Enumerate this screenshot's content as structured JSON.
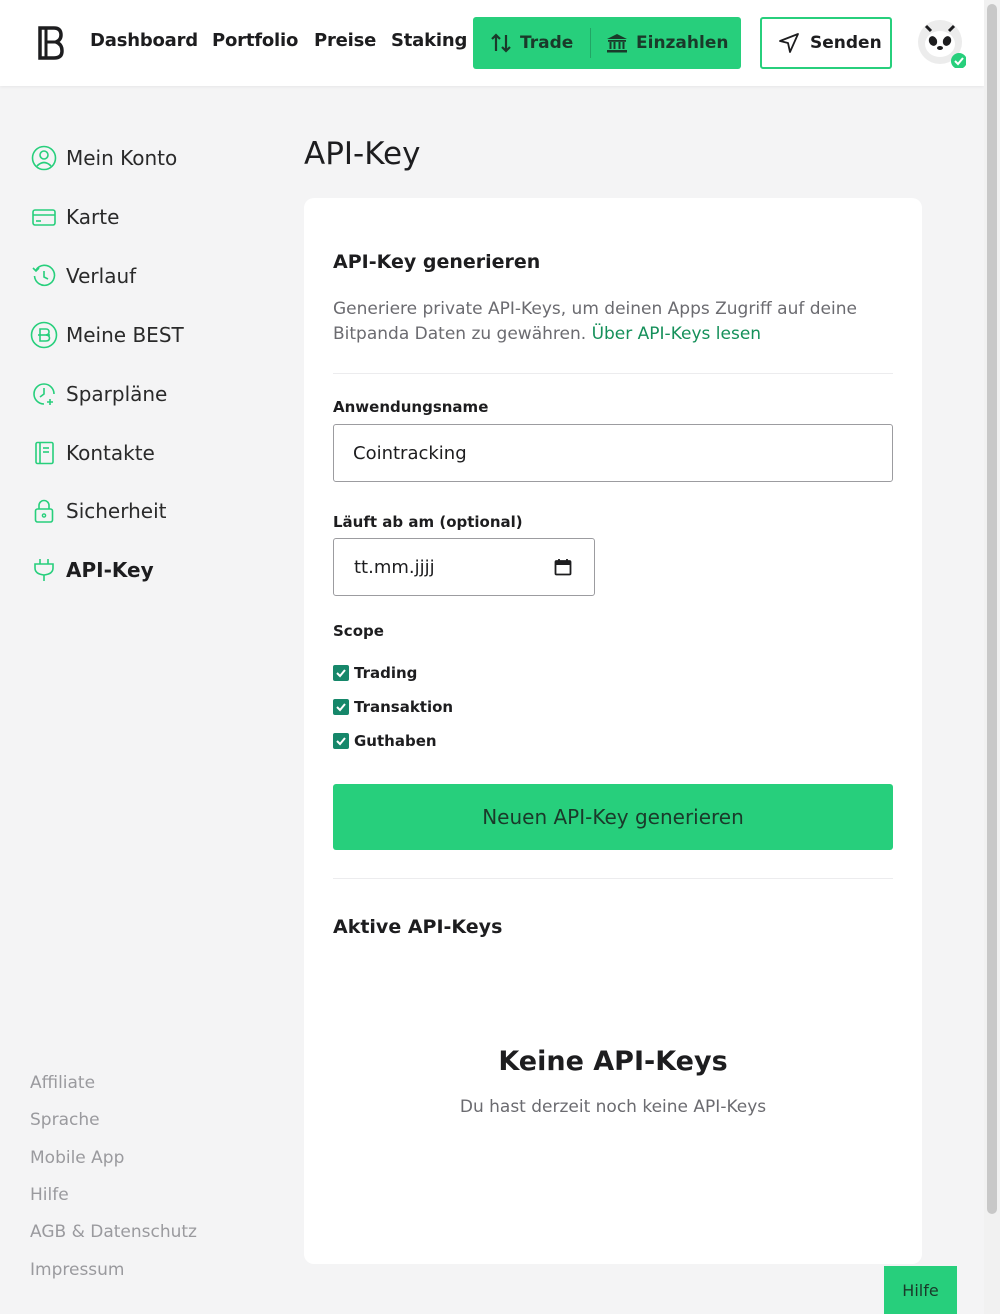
{
  "header": {
    "nav": [
      "Dashboard",
      "Portfolio",
      "Preise",
      "Staking"
    ],
    "trade_label": "Trade",
    "deposit_label": "Einzahlen",
    "send_label": "Senden"
  },
  "sidebar": {
    "items": [
      {
        "label": "Mein Konto",
        "icon": "user-icon"
      },
      {
        "label": "Karte",
        "icon": "card-icon"
      },
      {
        "label": "Verlauf",
        "icon": "history-icon"
      },
      {
        "label": "Meine BEST",
        "icon": "best-coin-icon"
      },
      {
        "label": "Sparpläne",
        "icon": "savings-plan-icon"
      },
      {
        "label": "Kontakte",
        "icon": "contacts-icon"
      },
      {
        "label": "Sicherheit",
        "icon": "lock-icon"
      },
      {
        "label": "API-Key",
        "icon": "plug-icon",
        "active": true
      }
    ],
    "footer": [
      "Affiliate",
      "Sprache",
      "Mobile App",
      "Hilfe",
      "AGB & Datenschutz",
      "Impressum"
    ]
  },
  "main": {
    "page_title": "API-Key",
    "section_title": "API-Key generieren",
    "description": "Generiere private API-Keys, um deinen Apps Zugriff auf deine Bitpanda Daten zu gewähren.",
    "description_link": "Über API-Keys lesen",
    "app_name_label": "Anwendungsname",
    "app_name_value": "Cointracking",
    "expiry_label": "Läuft ab am (optional)",
    "expiry_placeholder": "tt.mm.jjjj",
    "scope_label": "Scope",
    "scopes": [
      {
        "label": "Trading",
        "checked": true
      },
      {
        "label": "Transaktion",
        "checked": true
      },
      {
        "label": "Guthaben",
        "checked": true
      }
    ],
    "generate_button": "Neuen API-Key generieren",
    "active_keys_title": "Aktive API-Keys",
    "empty_title": "Keine API-Keys",
    "empty_subtitle": "Du hast derzeit noch keine API-Keys"
  },
  "help_button": "Hilfe",
  "colors": {
    "accent": "#27cf7c",
    "link": "#15905a",
    "checkbox": "#16876a"
  }
}
